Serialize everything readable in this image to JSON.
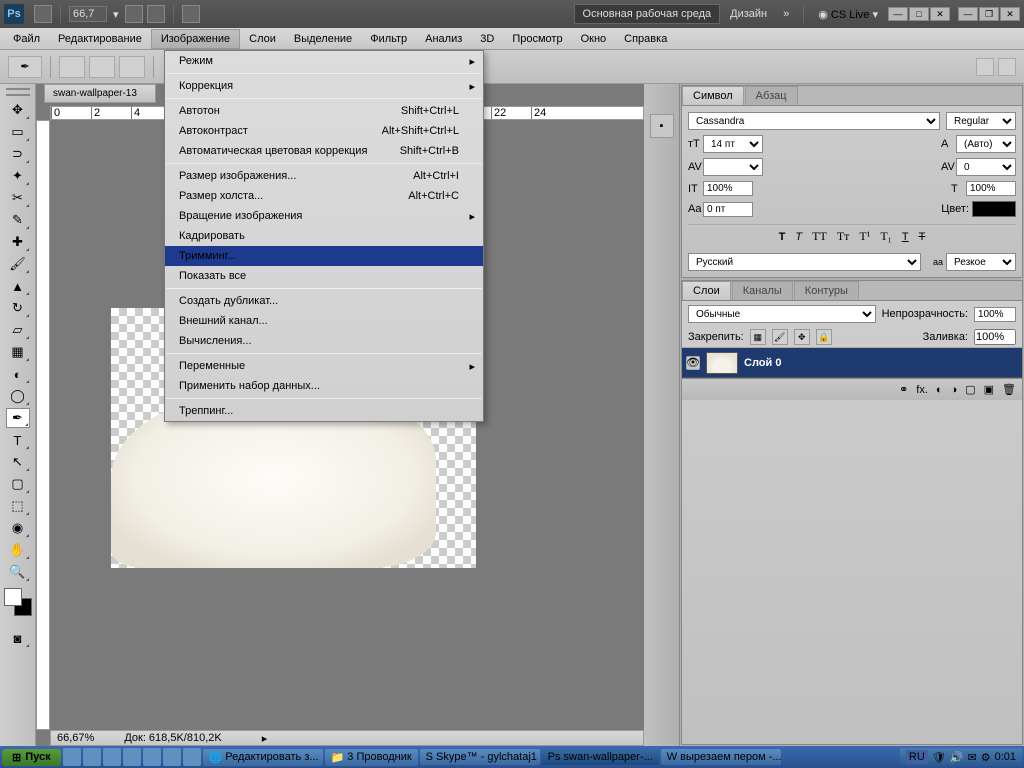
{
  "topbar": {
    "app": "Ps",
    "zoom": "66,7",
    "workspace": "Основная рабочая среда",
    "design": "Дизайн",
    "cslive": "CS Live"
  },
  "menu": {
    "file": "Файл",
    "edit": "Редактирование",
    "image": "Изображение",
    "layers": "Слои",
    "select": "Выделение",
    "filter": "Фильтр",
    "analysis": "Анализ",
    "threed": "3D",
    "view": "Просмотр",
    "window": "Окно",
    "help": "Справка"
  },
  "dropdown": {
    "mode": "Режим",
    "adjust": "Коррекция",
    "autotone": "Автотон",
    "autocontrast": "Автоконтраст",
    "autocolor": "Автоматическая цветовая коррекция",
    "sc1": "Shift+Ctrl+L",
    "sc2": "Alt+Shift+Ctrl+L",
    "sc3": "Shift+Ctrl+B",
    "imgsize": "Размер изображения...",
    "canvassize": "Размер холста...",
    "rotate": "Вращение изображения",
    "crop": "Кадрировать",
    "trim": "Тримминг...",
    "reveal": "Показать все",
    "sc4": "Alt+Ctrl+I",
    "sc5": "Alt+Ctrl+C",
    "dup": "Создать дубликат...",
    "apply": "Внешний канал...",
    "calc": "Вычисления...",
    "vars": "Переменные",
    "applyset": "Применить набор данных...",
    "trap": "Треппинг..."
  },
  "doctab": "swan-wallpaper-13",
  "status": {
    "zoom": "66,67%",
    "doc": "Док: 618,5K/810,2K"
  },
  "char": {
    "tab1": "Символ",
    "tab2": "Абзац",
    "font": "Cassandra",
    "style": "Regular",
    "size": "14 пт",
    "leading": "(Авто)",
    "tracking": "0",
    "vscale": "100%",
    "hscale": "100%",
    "baseline": "0 пт",
    "colorlbl": "Цвет:",
    "lang": "Русский",
    "aa": "Резкое"
  },
  "layers": {
    "tab1": "Слои",
    "tab2": "Каналы",
    "tab3": "Контуры",
    "blend": "Обычные",
    "opacitylbl": "Непрозрачность:",
    "opacity": "100%",
    "locklbl": "Закрепить:",
    "filllbl": "Заливка:",
    "fill": "100%",
    "layer0": "Слой 0"
  },
  "taskbar": {
    "start": "Пуск",
    "t1": "Редактировать з...",
    "t2": "3 Проводник",
    "t3": "Skype™ - gylchataj1",
    "t4": "swan-wallpaper-...",
    "t5": "вырезаем пером -...",
    "lang": "RU",
    "time": "0:01"
  }
}
